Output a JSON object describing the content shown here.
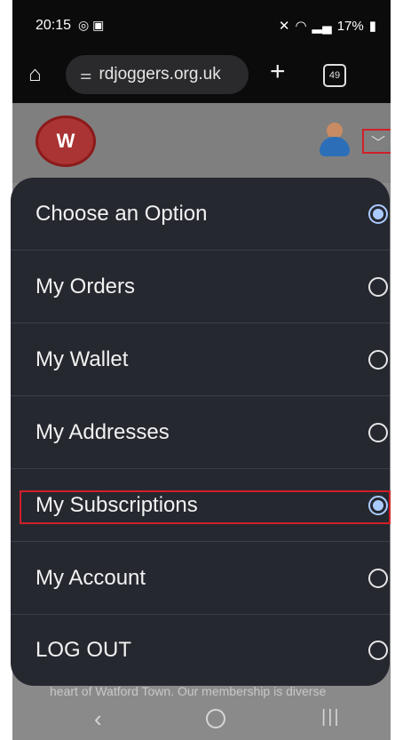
{
  "status_bar": {
    "time": "20:15",
    "battery": "17%"
  },
  "browser": {
    "url": "rdjoggers.org.uk",
    "tab_count": "49"
  },
  "menu": {
    "items": [
      {
        "label": "Choose an Option",
        "checked": true
      },
      {
        "label": "My Orders",
        "checked": false
      },
      {
        "label": "My Wallet",
        "checked": false
      },
      {
        "label": "My Addresses",
        "checked": false
      },
      {
        "label": "My Subscriptions",
        "checked": true
      },
      {
        "label": "My Account",
        "checked": false
      },
      {
        "label": "LOG OUT",
        "checked": false
      }
    ]
  },
  "page": {
    "partial_text": "heart of Watford Town. Our membership is diverse"
  },
  "colors": {
    "menu_bg": "#262830",
    "radio_selected": "#aacbff",
    "highlight": "#d0202a"
  }
}
